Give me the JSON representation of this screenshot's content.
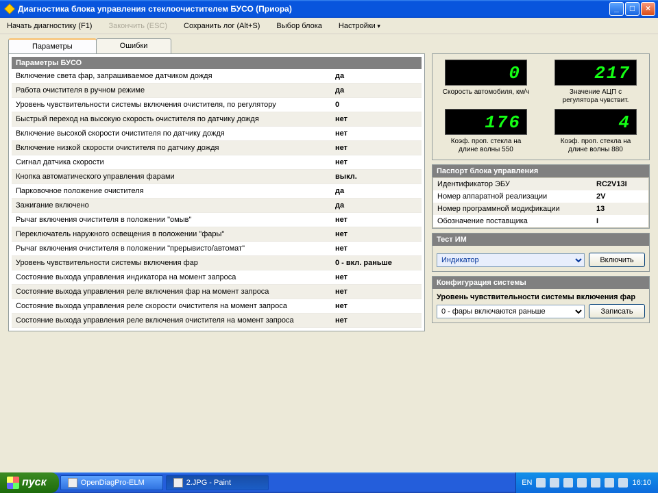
{
  "window": {
    "title": "Диагностика блока управления стеклоочистителем БУСО (Приора)"
  },
  "menu": {
    "start": "Начать диагностику (F1)",
    "stop": "Закончить (ESC)",
    "savelog": "Сохранить лог (Alt+S)",
    "selblock": "Выбор блока",
    "settings": "Настройки"
  },
  "tabs": {
    "params": "Параметры",
    "errors": "Ошибки"
  },
  "grid": {
    "title": "Параметры БУСО",
    "rows": [
      {
        "label": "Включение света фар, запрашиваемое датчиком дождя",
        "val": "да"
      },
      {
        "label": "Работа очистителя в ручном режиме",
        "val": "да"
      },
      {
        "label": "Уровень чувствительности системы включения очистителя, по регулятору",
        "val": "0"
      },
      {
        "label": "Быстрый переход на высокую скорость очистителя по датчику дождя",
        "val": "нет"
      },
      {
        "label": "Включение высокой скорости очистителя по датчику дождя",
        "val": "нет"
      },
      {
        "label": "Включение низкой скорости очистителя по датчику дождя",
        "val": "нет"
      },
      {
        "label": "Сигнал датчика скорости",
        "val": "нет"
      },
      {
        "label": "Кнопка автоматического управления фарами",
        "val": "выкл."
      },
      {
        "label": "Парковочное положение очистителя",
        "val": "да"
      },
      {
        "label": "Зажигание включено",
        "val": "да"
      },
      {
        "label": "Рычаг включения очистителя в положении \"омыв\"",
        "val": "нет"
      },
      {
        "label": "Переключатель наружного освещения в положении \"фары\"",
        "val": "нет"
      },
      {
        "label": "Рычаг включения очистителя в положении \"прерывисто/автомат\"",
        "val": "нет"
      },
      {
        "label": "Уровень чувствительности системы включения фар",
        "val": "0 - вкл. раньше"
      },
      {
        "label": "Состояние выхода управления индикатора на момент запроса",
        "val": "нет"
      },
      {
        "label": "Состояние выхода управления реле включения фар на момент запроса",
        "val": "нет"
      },
      {
        "label": "Состояние выхода управления реле скорости очистителя на момент запроса",
        "val": "нет"
      },
      {
        "label": "Состояние выхода управления реле включения очистителя на момент запроса",
        "val": "нет"
      }
    ]
  },
  "gauges": [
    {
      "value": "0",
      "label": "Скорость автомобиля, км/ч"
    },
    {
      "value": "217",
      "label": "Значение АЦП с регулятора чувствит."
    },
    {
      "value": "176",
      "label": "Коэф. проп. стекла на длине волны 550"
    },
    {
      "value": "4",
      "label": "Коэф. проп. стекла на длине волны 880"
    }
  ],
  "passport": {
    "title": "Паспорт блока управления",
    "items": [
      {
        "k": "Идентификатор ЭБУ",
        "v": "RC2V13I"
      },
      {
        "k": "Номер аппаратной реализации",
        "v": "2V"
      },
      {
        "k": "Номер программной модификации",
        "v": "13"
      },
      {
        "k": "Обозначение поставщика",
        "v": "I"
      }
    ]
  },
  "testim": {
    "title": "Тест ИМ",
    "option": "Индикатор",
    "button": "Включить"
  },
  "config": {
    "title": "Конфигурация системы",
    "label": "Уровень чувствительности системы включения фар",
    "option": "0 - фары включаются раньше",
    "button": "Записать"
  },
  "taskbar": {
    "start": "пуск",
    "btn1": "OpenDiagPro-ELM",
    "btn2": "2.JPG - Paint",
    "lang": "EN",
    "time": "16:10"
  }
}
